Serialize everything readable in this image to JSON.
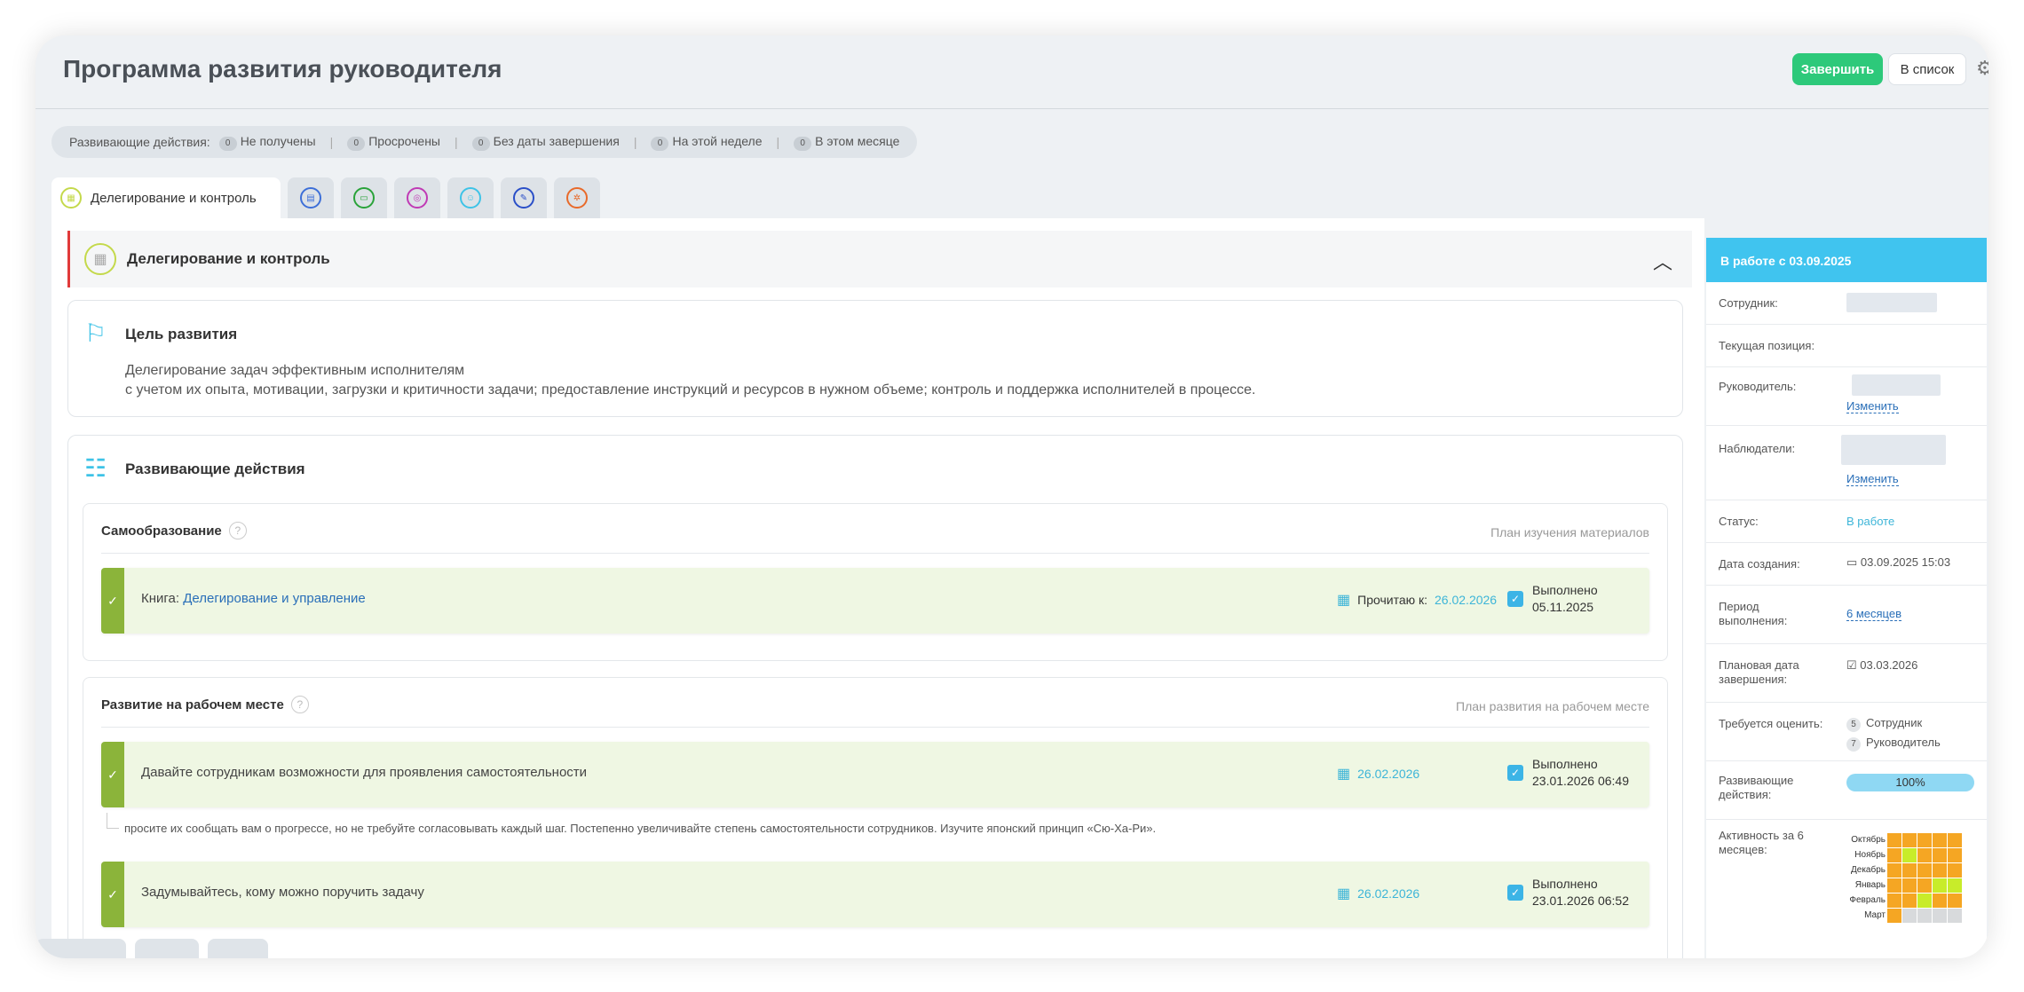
{
  "header": {
    "title": "Программа развития руководителя",
    "finish_label": "Завершить",
    "list_label": "В список"
  },
  "filters": {
    "label": "Развивающие действия:",
    "items": [
      {
        "count": "0",
        "label": "Не получены"
      },
      {
        "count": "0",
        "label": "Просрочены"
      },
      {
        "count": "0",
        "label": "Без даты завершения"
      },
      {
        "count": "0",
        "label": "На этой неделе"
      },
      {
        "count": "0",
        "label": "В этом месяце"
      }
    ]
  },
  "tabs": {
    "active_label": "Делегирование и контроль",
    "icon_colors": [
      "#c4d94b",
      "#3d6fd8",
      "#2aa33a",
      "#c03ab5",
      "#3ec3e7",
      "#2a4fc8",
      "#e86a2a"
    ]
  },
  "section": {
    "title": "Делегирование и контроль",
    "goal": {
      "title": "Цель развития",
      "line1": "Делегирование задач эффективным исполнителям",
      "line2": "с учетом их опыта, мотивации, загрузки и критичности задачи; предоставление инструкций и ресурсов в нужном объеме; контроль и поддержка исполнителей в процессе."
    },
    "actions": {
      "title": "Развивающие действия",
      "self": {
        "title": "Самообразование",
        "plan": "План изучения материалов",
        "item": {
          "prefix": "Книга: ",
          "link": "Делегирование и управление",
          "date_label": "Прочитаю к:",
          "date": "26.02.2026",
          "done_label": "Выполнено",
          "done_date": "05.11.2025"
        }
      },
      "work": {
        "title": "Развитие на рабочем месте",
        "plan": "План развития на рабочем месте",
        "items": [
          {
            "text": "Давайте сотрудникам возможности для проявления самостоятельности",
            "date": "26.02.2026",
            "done_label": "Выполнено",
            "done_date": "23.01.2026 06:49",
            "note": "просите их сообщать вам о прогрессе, но не требуйте согласовывать каждый шаг. Постепенно увеличивайте степень самостоятельности сотрудников. Изучите японский принцип «Сю-Ха-Ри»."
          },
          {
            "text": "Задумывайтесь, кому можно поручить задачу",
            "date": "26.02.2026",
            "done_label": "Выполнено",
            "done_date": "23.01.2026 06:52"
          }
        ]
      }
    }
  },
  "side": {
    "header": "В работе с 03.09.2025",
    "employee_label": "Сотрудник:",
    "position_label": "Текущая позиция:",
    "manager_label": "Руководитель:",
    "observers_label": "Наблюдатели:",
    "change_label": "Изменить",
    "status_label": "Статус:",
    "status_value": "В работе",
    "created_label": "Дата создания:",
    "created_value": "03.09.2025 15:03",
    "period_label_1": "Период",
    "period_label_2": "выполнения:",
    "period_value": "6 месяцев",
    "planned_label_1": "Плановая дата",
    "planned_label_2": "завершения:",
    "planned_value": "03.03.2026",
    "assess_label": "Требуется оценить:",
    "assess": [
      {
        "count": "5",
        "label": "Сотрудник"
      },
      {
        "count": "7",
        "label": "Руководитель"
      }
    ],
    "progress_label_1": "Развивающие",
    "progress_label_2": "действия:",
    "progress_value": "100%",
    "progress_fraction": 1.0,
    "activity_label_1": "Активность за 6",
    "activity_label_2": "месяцев:",
    "activity_months": [
      "Октябрь",
      "Ноябрь",
      "Декабрь",
      "Январь",
      "Февраль",
      "Март"
    ],
    "activity_colors": {
      "orange": "#f5a623",
      "green": "#c8ec2a",
      "gray": "#d8dadc"
    }
  }
}
